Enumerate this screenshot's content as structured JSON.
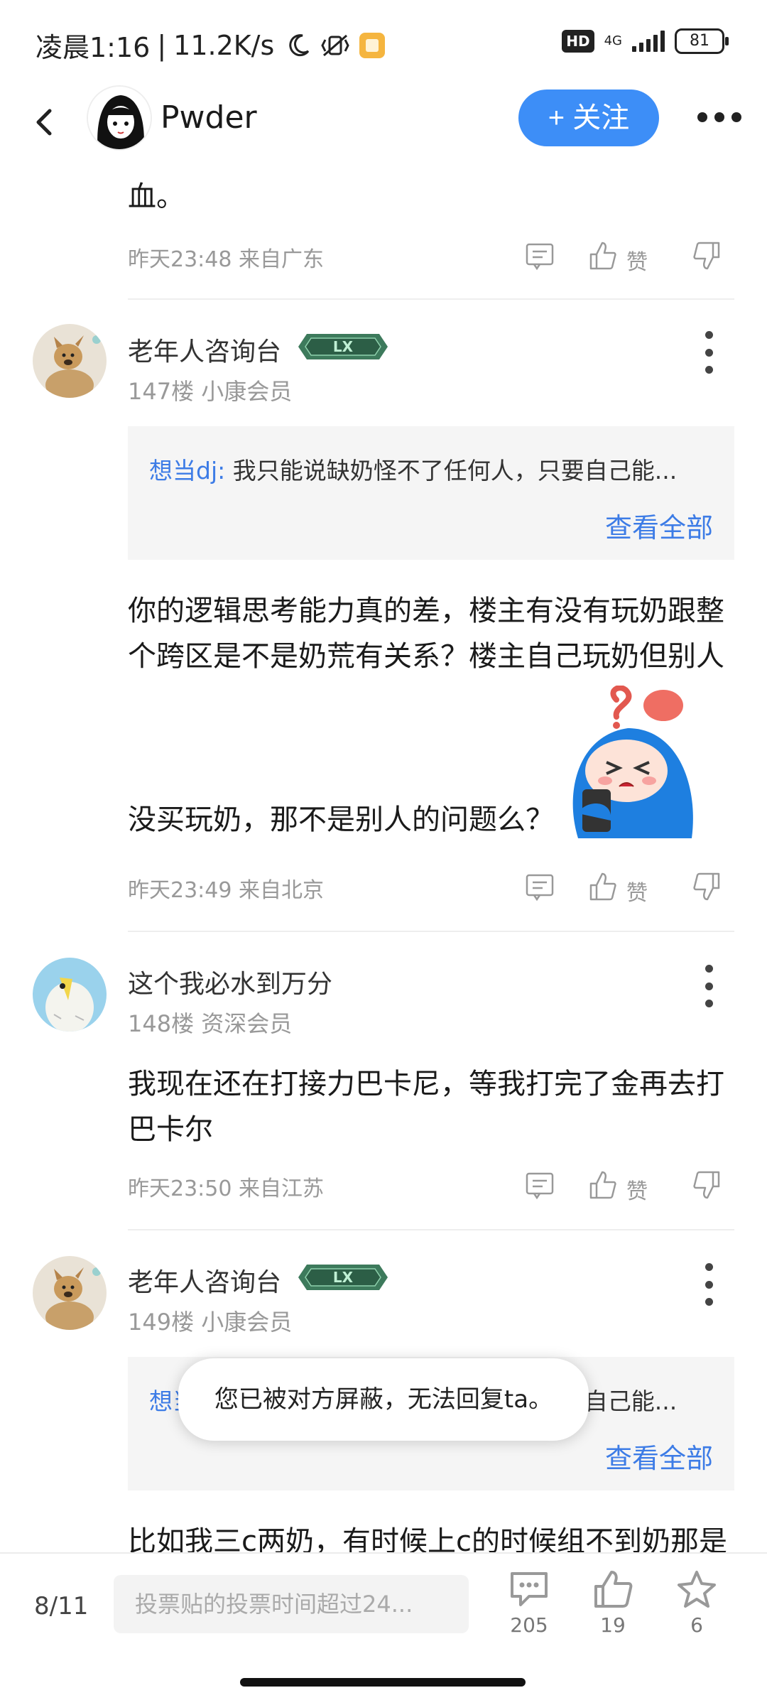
{
  "status_bar": {
    "time": "凌晨1:16",
    "net_speed": "11.2K/s",
    "hd": "HD",
    "network": "4G",
    "battery": "81"
  },
  "header": {
    "username": "Pwder",
    "follow_label": "+ 关注",
    "accent_color": "#3d8ef7"
  },
  "prev_post": {
    "text_tail": "血。",
    "meta": "昨天23:48 来自广东",
    "like_label": "赞"
  },
  "comments": [
    {
      "username": "老年人咨询台",
      "has_badge": true,
      "floor_info": "147楼 小康会员",
      "quote": {
        "user": "想当dj:",
        "text": " 我只能说缺奶怪不了任何人，只要自己能...",
        "view_all": "查看全部"
      },
      "text_line1": "你的逻辑思考能力真的差，楼主有没有玩奶跟整",
      "text_line2": "个跨区是不是奶荒有关系？楼主自己玩奶但别人",
      "text_line3": "没买玩奶，那不是别人的问题么？",
      "meta": "昨天23:49 来自北京",
      "like_label": "赞"
    },
    {
      "username": "这个我必水到万分",
      "has_badge": false,
      "floor_info": "148楼 资深会员",
      "text_line1": "我现在还在打接力巴卡尼，等我打完了金再去打",
      "text_line2": "巴卡尔",
      "meta": "昨天23:50 来自江苏",
      "like_label": "赞"
    },
    {
      "username": "老年人咨询台",
      "has_badge": true,
      "floor_info": "149楼 小康会员",
      "quote": {
        "user": "想当dj:",
        "text": " 我只能说缺奶怪不了任何人，只要自己能...",
        "view_all": "查看全部"
      },
      "text_line1": "比如我三c两奶，有时候上c的时候组不到奶那是"
    }
  ],
  "toast": "您已被对方屏蔽，无法回复ta。",
  "bottom_bar": {
    "page_indicator": "8/11",
    "input_placeholder": "投票贴的投票时间超过24...",
    "comment_count": "205",
    "like_count": "19",
    "star_count": "6"
  }
}
